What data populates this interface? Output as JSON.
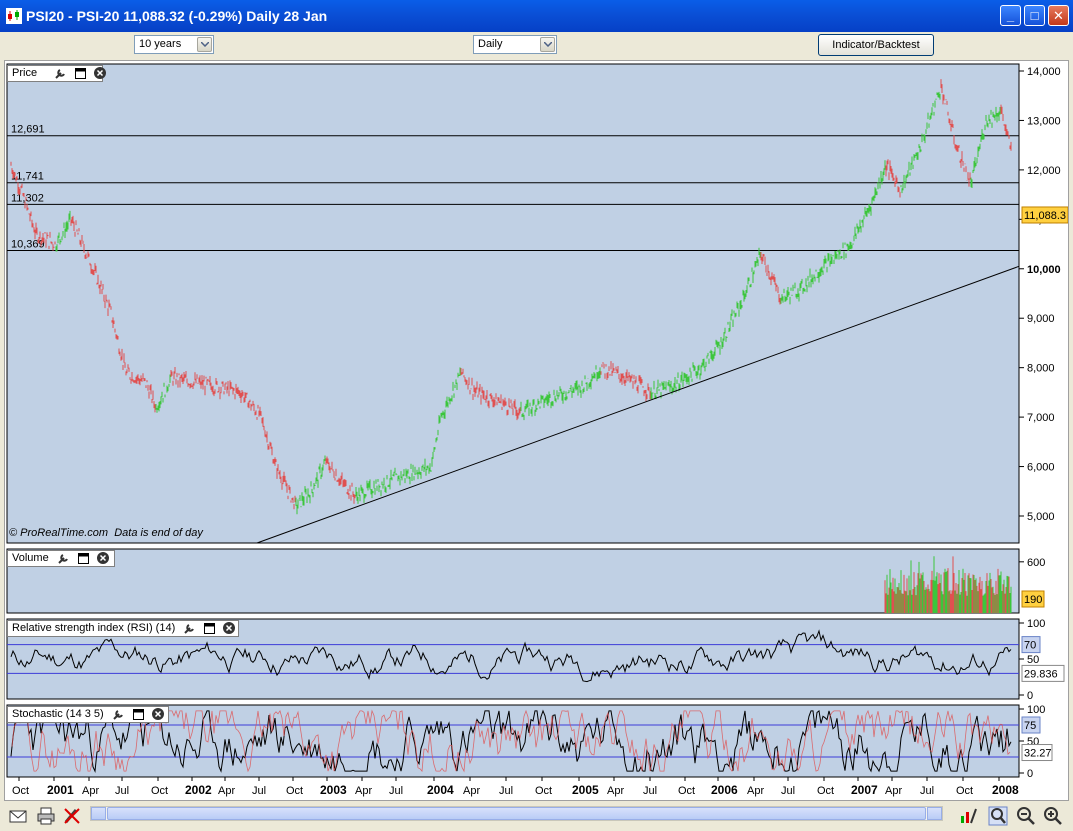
{
  "window": {
    "title": "PSI20 - PSI-20     11,088.32 (-0.29%)     Daily  28 Jan",
    "minimize": "_",
    "maximize": "□",
    "close": "✕"
  },
  "toolbar": {
    "period_select": "10 years",
    "interval_select": "Daily",
    "indicator_button": "Indicator/Backtest"
  },
  "panels": {
    "price": {
      "label": "Price",
      "copyright": "© ProRealTime.com",
      "note": "Data is end of day",
      "y_ticks": [
        "14,000",
        "13,000",
        "12,000",
        "11,000",
        "10,000",
        "9,000",
        "8,000",
        "7,000",
        "6,000",
        "5,000"
      ],
      "bold_tick": "10,000",
      "h_lines": [
        "12,691",
        "11,741",
        "11,302",
        "10,369"
      ],
      "current_price": "11,088.3"
    },
    "volume": {
      "label": "Volume",
      "y_ticks": [
        "600"
      ],
      "current": "190"
    },
    "rsi": {
      "label": "Relative strength index (RSI) (14)",
      "y_ticks": [
        "100",
        "50",
        "0"
      ],
      "level": "70",
      "current": "29.836"
    },
    "stochastic": {
      "label": "Stochastic (14 3 5)",
      "y_ticks": [
        "100",
        "50",
        "0"
      ],
      "level": "75",
      "current": "32.27"
    }
  },
  "x_axis": {
    "labels": [
      {
        "t": "Oct",
        "bold": false
      },
      {
        "t": "2001",
        "bold": true
      },
      {
        "t": "Apr",
        "bold": false
      },
      {
        "t": "Jul",
        "bold": false
      },
      {
        "t": "Oct",
        "bold": false
      },
      {
        "t": "2002",
        "bold": true
      },
      {
        "t": "Apr",
        "bold": false
      },
      {
        "t": "Jul",
        "bold": false
      },
      {
        "t": "Oct",
        "bold": false
      },
      {
        "t": "2003",
        "bold": true
      },
      {
        "t": "Apr",
        "bold": false
      },
      {
        "t": "Jul",
        "bold": false
      },
      {
        "t": "2004",
        "bold": true
      },
      {
        "t": "Apr",
        "bold": false
      },
      {
        "t": "Jul",
        "bold": false
      },
      {
        "t": "Oct",
        "bold": false
      },
      {
        "t": "2005",
        "bold": true
      },
      {
        "t": "Apr",
        "bold": false
      },
      {
        "t": "Jul",
        "bold": false
      },
      {
        "t": "Oct",
        "bold": false
      },
      {
        "t": "2006",
        "bold": true
      },
      {
        "t": "Apr",
        "bold": false
      },
      {
        "t": "Jul",
        "bold": false
      },
      {
        "t": "Oct",
        "bold": false
      },
      {
        "t": "2007",
        "bold": true
      },
      {
        "t": "Apr",
        "bold": false
      },
      {
        "t": "Jul",
        "bold": false
      },
      {
        "t": "Oct",
        "bold": false
      },
      {
        "t": "2008",
        "bold": true
      }
    ]
  },
  "colors": {
    "panel_bg": "#c0d0e4",
    "up": "#3cc63c",
    "down": "#e05050",
    "line": "#000000",
    "level_line": "#3c3cd8",
    "price_badge": "#ffd040"
  },
  "icons": [
    "wrench-icon",
    "window-icon",
    "close-icon",
    "email-icon",
    "print-icon",
    "no-edit-icon",
    "drawing-icon",
    "zoom-box-icon",
    "zoom-out-icon",
    "zoom-in-icon"
  ]
}
